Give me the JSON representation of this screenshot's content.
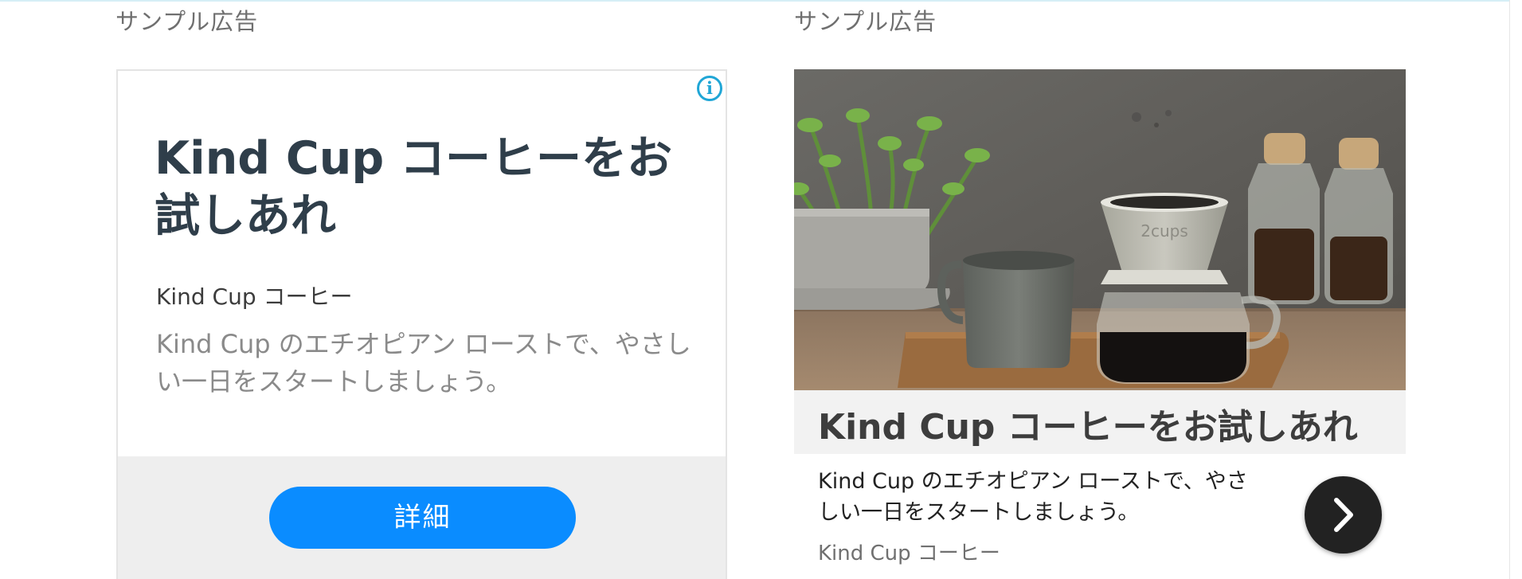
{
  "left_ad": {
    "label": "サンプル広告",
    "info_glyph": "i",
    "headline": "Kind Cup コーヒーをお試しあれ",
    "advertiser": "Kind Cup コーヒー",
    "description": "Kind Cup のエチオピアン ローストで、やさしい一日をスタートしましょう。",
    "button_label": "詳細",
    "colors": {
      "headline": "#2f3e4a",
      "button": "#0a8cff",
      "info": "#20a6d6",
      "footer": "#eeeeee"
    }
  },
  "right_ad": {
    "label": "サンプル広告",
    "headline": "Kind Cup コーヒーをお試しあれ",
    "description": "Kind Cup のエチオピアン ローストで、やさしい一日をスタートしましょう。",
    "advertiser": "Kind Cup コーヒー",
    "next_icon": "chevron-right-icon",
    "colors": {
      "headline_bar": "#f2f2f2",
      "next_button": "#222222"
    }
  }
}
